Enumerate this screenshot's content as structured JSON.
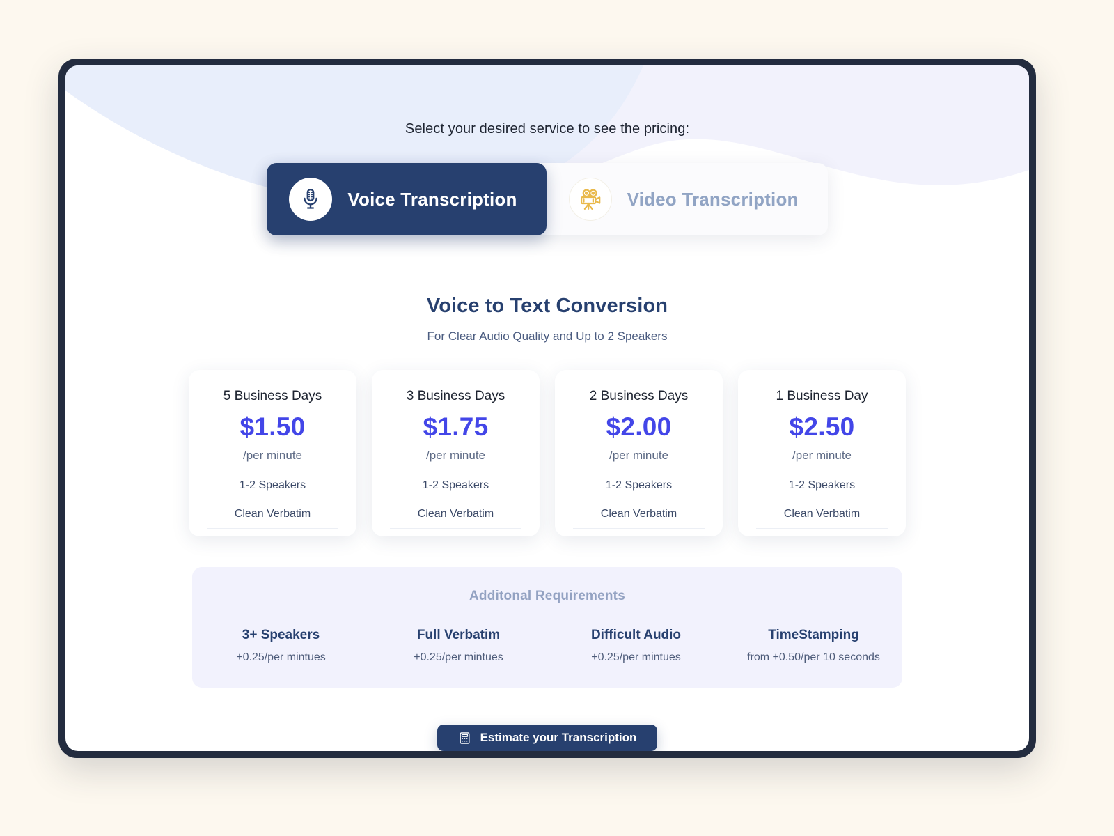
{
  "prompt": {
    "text": "Select your desired service to see the pricing:"
  },
  "service_tabs": [
    {
      "label": "Voice Transcription",
      "icon": "microphone-icon",
      "active": true
    },
    {
      "label": "Video Transcription",
      "icon": "movie-camera-icon",
      "active": false
    }
  ],
  "section": {
    "title": "Voice to Text Conversion",
    "subtitle": "For Clear Audio Quality and Up to 2 Speakers"
  },
  "pricing_cards": [
    {
      "term": "5 Business Days",
      "price": "$1.50",
      "unit": "/per minute",
      "feature_1": "1-2 Speakers",
      "feature_2": "Clean Verbatim"
    },
    {
      "term": "3 Business Days",
      "price": "$1.75",
      "unit": "/per minute",
      "feature_1": "1-2 Speakers",
      "feature_2": "Clean Verbatim"
    },
    {
      "term": "2 Business Days",
      "price": "$2.00",
      "unit": "/per minute",
      "feature_1": "1-2 Speakers",
      "feature_2": "Clean Verbatim"
    },
    {
      "term": "1 Business Day",
      "price": "$2.50",
      "unit": "/per minute",
      "feature_1": "1-2 Speakers",
      "feature_2": "Clean Verbatim"
    }
  ],
  "addons": {
    "title": "Additonal Requirements",
    "items": [
      {
        "name": "3+ Speakers",
        "price": "+0.25/per mintues"
      },
      {
        "name": "Full Verbatim",
        "price": "+0.25/per mintues"
      },
      {
        "name": "Difficult Audio",
        "price": "+0.25/per mintues"
      },
      {
        "name": "TimeStamping",
        "price": "from +0.50/per 10 seconds"
      }
    ]
  },
  "cta": {
    "label": "Estimate your Transcription",
    "icon": "calculator-icon"
  },
  "colors": {
    "page_background": "#fdf8ef",
    "frame_border": "#232c3f",
    "navy": "#27406f",
    "price_blue": "#4346e8",
    "muted_blue": "#91a4c4",
    "addons_background": "#f2f2fd",
    "wave_blue": "#e8eefb",
    "wave_lavender": "#f2f2fc",
    "camera_gold": "#e9b94b"
  }
}
